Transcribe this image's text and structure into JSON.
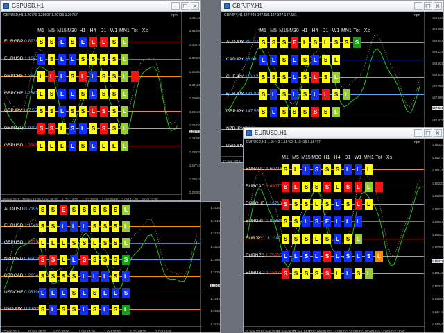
{
  "windows": [
    {
      "id": "w1",
      "title": "GBPUSD,H1",
      "info": "GBPUSD,H1 1.29770 1.29807 1.29730 1.29757",
      "rgm": "rgm",
      "columns": [
        "M1",
        "M5",
        "M15",
        "M30",
        "H1",
        "H4",
        "D1",
        "W1",
        "MN1",
        "Tot",
        "Xs"
      ],
      "rows": [
        {
          "pair": "EURGBP",
          "value": "0.89384",
          "neg": false,
          "cells": [
            "Y:S",
            "Y:S",
            "B:L",
            "Y:S",
            "B:E",
            "R:L",
            "R:L",
            "Y:S",
            "LG:L"
          ]
        },
        {
          "pair": "EURUSD",
          "value": "1.16079",
          "neg": false,
          "cells": [
            "B:L",
            "Y:S",
            "B:L",
            "B:L",
            "Y:S",
            "Y:S",
            "Y:S",
            "Y:S",
            "LG:L"
          ]
        },
        {
          "pair": "GBPCHF",
          "value": "1.26475",
          "neg": false,
          "cells": [
            "Y:L",
            "R:L",
            "B:L",
            "Y:S",
            "R:L",
            "B:L",
            "Y:S",
            "Y:S",
            "LG:L",
            "R:"
          ]
        },
        {
          "pair": "GBPCHF",
          "value": "1.26475",
          "neg": false,
          "cells": [
            "Y:L",
            "Y:S",
            "B:L",
            "B:L",
            "Y:S",
            "B:L",
            "Y:S",
            "Y:S",
            "LG:L"
          ]
        },
        {
          "pair": "GBPJPY",
          "value": "147.557",
          "neg": false,
          "cells": [
            "Y:S",
            "Y:S",
            "B:L",
            "Y:S",
            "Y:S",
            "R:L",
            "R:S",
            "Y:S",
            "LG:L"
          ]
        },
        {
          "pair": "GBPNZD",
          "value": "1.97041",
          "neg": false,
          "cells": [
            "R:S",
            "R:S",
            "Y:L",
            "B:S",
            "B:L",
            "Y:S",
            "R:S",
            "Y:S",
            "LG:L"
          ]
        },
        {
          "pair": "GBPUSD",
          "value": "1.29800",
          "neg": true,
          "cells": [
            "Y:L",
            "Y:L",
            "Y:L",
            "B:L",
            "Y:S",
            "B:L",
            "Y:L",
            "Y:L",
            "LG:L"
          ]
        }
      ],
      "prices": [
        "1.31145",
        "1.31000",
        "1.30875",
        "1.30580",
        "1.30350",
        "1.30120",
        "1.29890",
        "1.29660",
        "1.29430",
        "1.29200",
        "1.28970",
        "1.28740",
        "1.28510",
        "1.28280"
      ],
      "bid_price": "1.29757",
      "dates": [
        "26 Sep 2018",
        "28 Sep 16:00",
        "1 Oct 06:00",
        "1 Oct 14:00",
        "1 Oct 22:00",
        "2 Oct 06:00",
        "2 Oct 14:00",
        "2 Oct 22:00"
      ]
    },
    {
      "id": "w2",
      "title": "GBPJPY,H1",
      "info": "GBPJPY,H1 147.440 147.531 147.347 147.531",
      "rgm": "rgm",
      "columns": [
        "M1",
        "M5",
        "M15",
        "M30",
        "H1",
        "H4",
        "D1",
        "W1",
        "MN1",
        "Tot",
        "Xs"
      ],
      "rows": [
        {
          "pair": "AUDJPY",
          "value": "81.711",
          "neg": false,
          "cells": [
            "Y:S",
            "Y:S",
            "Y:S",
            "R:E",
            "Y:L",
            "Y:S",
            "Y:L",
            "Y:S",
            "Y:S",
            "G:S"
          ]
        },
        {
          "pair": "CADJPY",
          "value": "88.06",
          "neg": false,
          "cells": [
            "B:L",
            "B:L",
            "Y:S",
            "B:L",
            "Y:S",
            "B:L",
            "Y:S",
            "Y:L"
          ]
        },
        {
          "pair": "CHFJPY",
          "value": "116.12",
          "neg": false,
          "cells": [
            "Y:S",
            "Y:S",
            "Y:S",
            "B:L",
            "Y:S",
            "R:L",
            "Y:S",
            "LG:L"
          ]
        },
        {
          "pair": "EURJPY",
          "value": "131.82",
          "neg": false,
          "cells": [
            "Y:S",
            "B:L",
            "Y:S",
            "B:L",
            "Y:S",
            "B:L",
            "R:L",
            "Y:S",
            "LG:L"
          ]
        },
        {
          "pair": "GBPJPY",
          "value": "147.557",
          "neg": false,
          "cells": [
            "Y:S",
            "B:L",
            "Y:S",
            "Y:S",
            "Y:S",
            "R:S",
            "Y:S",
            "LG:L"
          ]
        },
        {
          "pair": "NZDJPY",
          "value": "74.88",
          "neg": false,
          "cells": []
        },
        {
          "pair": "USDJPY",
          "value": "113.684",
          "neg": false,
          "cells": []
        }
      ],
      "prices": [
        "150.165",
        "149.855",
        "149.545",
        "149.235",
        "148.925",
        "148.615",
        "148.305",
        "147.995",
        "147.685",
        "147.375",
        "147.065",
        "146.755",
        "146.445"
      ],
      "bid_price": "147.531",
      "dates": [
        "27 Sep 2018"
      ]
    },
    {
      "id": "w3",
      "title": "",
      "info": "",
      "rgm": "",
      "columns": [],
      "rows": [
        {
          "pair": "AUDUSD",
          "value": "0.71957",
          "neg": false,
          "cells": [
            "Y:S",
            "Y:S",
            "R:E",
            "Y:S",
            "Y:S",
            "Y:S",
            "Y:S",
            "Y:S",
            "LG:L"
          ]
        },
        {
          "pair": "EURUSD",
          "value": "1.15493",
          "neg": false,
          "cells": [
            "Y:S",
            "Y:S",
            "B:L",
            "B:L",
            "B:L",
            "Y:S",
            "Y:S",
            "Y:S",
            "LG:L"
          ]
        },
        {
          "pair": "GBPUSD",
          "value": "1.29797",
          "neg": true,
          "cells": [
            "Y:L",
            "Y:L",
            "Y:L",
            "Y:S",
            "Y:S",
            "Y:L",
            "Y:S",
            "Y:S",
            "LG:L"
          ]
        },
        {
          "pair": "NZDUSD",
          "value": "0.65926",
          "neg": false,
          "cells": [
            "R:S",
            "R:S",
            "Y:L",
            "B:L",
            "R:S",
            "Y:S",
            "Y:S",
            "Y:S",
            "G:S"
          ]
        },
        {
          "pair": "USDCAD",
          "value": "1.28341",
          "neg": false,
          "cells": [
            "Y:S",
            "Y:S",
            "Y:S",
            "Y:S",
            "B:L",
            "B:L",
            "B:L",
            "Y:S",
            "B:L"
          ]
        },
        {
          "pair": "USDCHF",
          "value": "0.98196",
          "neg": false,
          "cells": [
            "B:L",
            "B:L",
            "B:L",
            "Y:S",
            "B:L",
            "Y:S",
            "B:L",
            "B:L",
            "B:S"
          ]
        },
        {
          "pair": "USDJPY",
          "value": "113.684",
          "neg": false,
          "cells": [
            "Y:S",
            "B:L",
            "Y:S",
            "Y:S",
            "B:L",
            "Y:S",
            "B:L",
            "Y:S",
            "G:L"
          ]
        }
      ],
      "prices": [
        "1.1630",
        "1.1618",
        "1.1610",
        "1.1603",
        "1.1590",
        "1.1575",
        "1.1560",
        "1.1545",
        "1.1530",
        "1.1515"
      ],
      "bid_price": "1.1549",
      "dates": [
        "27 Sep 2018",
        "28 Sep 08:00",
        "1 Oct 08:00",
        "1 Oct 14:00",
        "1 Oct 20:00",
        "2 Oct 08:00",
        "2 Oct 14:00"
      ]
    },
    {
      "id": "w4",
      "title": "EURUSD,H1",
      "info": "EURUSD,H1 1.15443 1.15493 1.15415 1.15477",
      "rgm": "rgm",
      "columns": [
        "M1",
        "M5",
        "M15",
        "M30",
        "H1",
        "H4",
        "D1",
        "W1",
        "MN1",
        "Tot",
        "Xs"
      ],
      "rows": [
        {
          "pair": "EURAUD",
          "value": "1.60716",
          "neg": false,
          "cells": [
            "Y:S",
            "Y:L",
            "B:L",
            "B:S",
            "Y:S",
            "Y:S",
            "B:L",
            "B:L",
            "Y:L"
          ]
        },
        {
          "pair": "EURCAD",
          "value": "1.49070",
          "neg": true,
          "cells": [
            "R:S",
            "R:L",
            "Y:S",
            "Y:S",
            "R:S",
            "Y:L",
            "R:S",
            "R:L",
            "LG:L",
            "R:"
          ]
        },
        {
          "pair": "EURCHF",
          "value": "1.13710",
          "neg": false,
          "cells": [
            "R:S",
            "Y:S",
            "Y:S",
            "Y:L",
            "Y:S",
            "B:L",
            "Y:S",
            "R:L",
            "Y:L"
          ]
        },
        {
          "pair": "EURGBP",
          "value": "0.89384",
          "neg": false,
          "cells": [
            "Y:S",
            "Y:S",
            "B:L",
            "B:S",
            "B:E",
            "B:L",
            "B:L",
            "B:L"
          ]
        },
        {
          "pair": "EURJPY",
          "value": "131.387",
          "neg": false,
          "cells": [
            "Y:S",
            "Y:S",
            "Y:S",
            "Y:L",
            "Y:S",
            "B:L",
            "Y:S",
            "LG:L"
          ]
        },
        {
          "pair": "EURNZD",
          "value": "1.75085",
          "neg": true,
          "cells": [
            "B:L",
            "B:L",
            "B:S",
            "B:L",
            "R:S",
            "B:L",
            "B:S",
            "B:L",
            "B:S",
            "O:L"
          ]
        },
        {
          "pair": "EURUSD",
          "value": "1.15477",
          "neg": true,
          "cells": [
            "R:S",
            "Y:S",
            "Y:S",
            "Y:S",
            "R:S",
            "Y:L",
            "B:L",
            "Y:S",
            "LG:L"
          ]
        }
      ],
      "prices": [
        "1.16320",
        "1.16270",
        "1.16145",
        "1.16020",
        "1.15895",
        "1.15770",
        "1.15645",
        "1.15520",
        "1.15395",
        "1.15270",
        "1.15145",
        "1.15020",
        "1.14895",
        "1.14770",
        "1.14645"
      ],
      "bid_price": "1.15477",
      "dates": [
        "26 Sep 2018",
        "27 Sep 20:00",
        "28 Sep 06:00",
        "29 Sep 14:00",
        "1 Oct 06:00",
        "1 Oct 14:00",
        "1 Oct 22:00",
        "2 Oct 06:00",
        "2 Oct 14:00",
        "2 Oct 21:00"
      ]
    }
  ],
  "colors": {
    "yellow": "#ffff00",
    "blue": "#1030ff",
    "red": "#ff1010",
    "green": "#10a010",
    "lightgreen": "#9acd32",
    "orange": "#ff8c00",
    "chart_bg": "#000000"
  },
  "icons": [
    "window-icon",
    "minimize-icon",
    "maximize-icon",
    "close-icon"
  ]
}
